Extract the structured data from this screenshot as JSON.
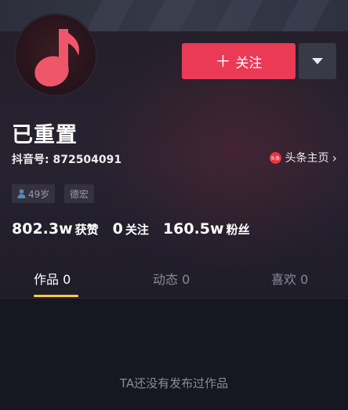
{
  "profile": {
    "name": "已重置",
    "douyin_id": "抖音号: 872504091",
    "toutiao_link": "头条主页",
    "toutiao_icon_text": "头条",
    "avatar_icon": "music-note-icon"
  },
  "actions": {
    "follow_label": "关注",
    "follow_plus": "＋",
    "more_icon": "chevron-down-icon"
  },
  "tags": {
    "age": "49岁",
    "location": "德宏"
  },
  "stats": {
    "likes_num": "802.3w",
    "likes_label": "获赞",
    "following_num": "0",
    "following_label": "关注",
    "fans_num": "160.5w",
    "fans_label": "粉丝"
  },
  "tabs": [
    {
      "label": "作品 0"
    },
    {
      "label": "动态 0"
    },
    {
      "label": "喜欢 0"
    }
  ],
  "empty_message": "TA还没有发布过作品",
  "colors": {
    "accent": "#ea3a56",
    "tab_indicator": "#f4c94a",
    "background": "#171722"
  }
}
